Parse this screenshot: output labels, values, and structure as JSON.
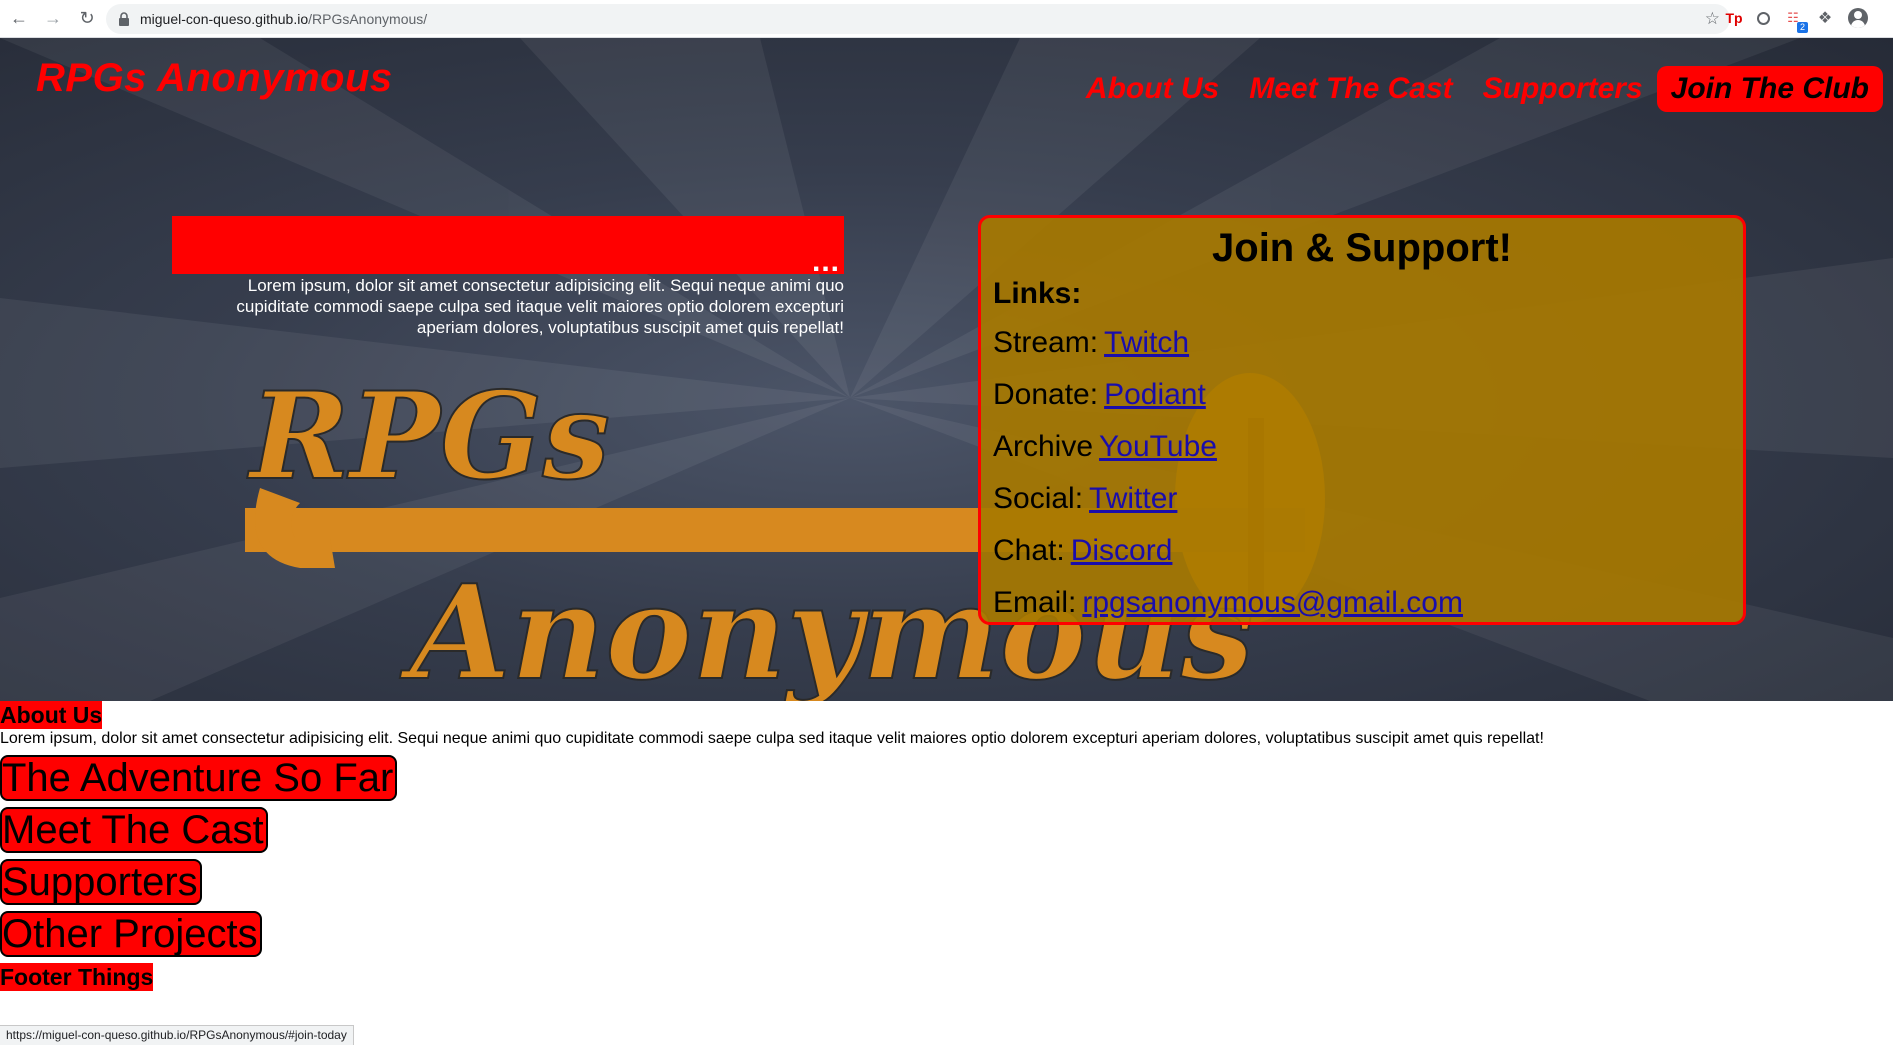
{
  "browser": {
    "url_host": "miguel-con-queso.github.io",
    "url_path": "/RPGsAnonymous/",
    "status_url": "https://miguel-con-queso.github.io/RPGsAnonymous/#join-today"
  },
  "header": {
    "title": "RPGs Anonymous",
    "nav": [
      "About Us",
      "Meet The Cast",
      "Supporters"
    ],
    "join_label": "Join The Club"
  },
  "hero": {
    "bar_text": "...",
    "paragraph": "Lorem ipsum, dolor sit amet consectetur adipisicing elit. Sequi neque animi quo cupiditate commodi saepe culpa sed itaque velit maiores optio dolorem excepturi aperiam dolores, voluptatibus suscipit amet quis repellat!",
    "logo_line1": "RPGs",
    "logo_line2": "Anonymous"
  },
  "join_card": {
    "title": "Join & Support!",
    "links_label": "Links:",
    "links": [
      {
        "label": "Stream:",
        "text": "Twitch"
      },
      {
        "label": "Donate:",
        "text": "Podiant"
      },
      {
        "label": "Archive",
        "text": "YouTube"
      },
      {
        "label": "Social:",
        "text": "Twitter"
      },
      {
        "label": "Chat:",
        "text": "Discord"
      },
      {
        "label": "Email:",
        "text": "rpgsanonymous@gmail.com"
      }
    ]
  },
  "main": {
    "about_heading": "About Us",
    "about_text": "Lorem ipsum, dolor sit amet consectetur adipisicing elit. Sequi neque animi quo cupiditate commodi saepe culpa sed itaque velit maiores optio dolorem excepturi aperiam dolores, voluptatibus suscipit amet quis repellat!",
    "sections": [
      "The Adventure So Far",
      "Meet The Cast",
      "Supporters",
      "Other Projects"
    ],
    "footer_heading": "Footer Things"
  },
  "colors": {
    "accent": "#ff0000",
    "card": "#a77800",
    "logo_gold": "#d7891f",
    "link": "#1a0dab"
  }
}
